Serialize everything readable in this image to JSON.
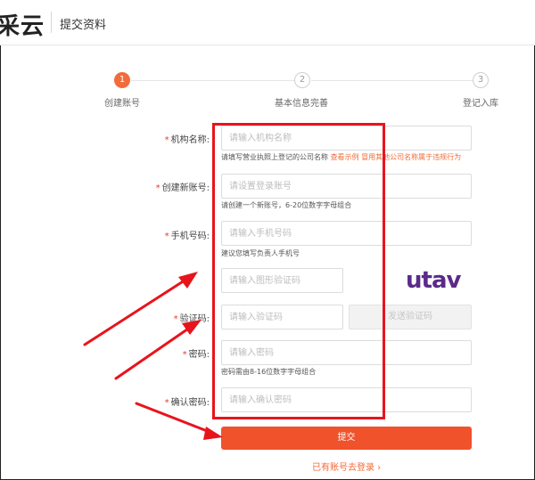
{
  "header": {
    "logo": "采云",
    "title": "提交资料"
  },
  "steps": [
    {
      "num": "1",
      "label": "创建账号",
      "active": true
    },
    {
      "num": "2",
      "label": "基本信息完善",
      "active": false
    },
    {
      "num": "3",
      "label": "登记入库",
      "active": false
    }
  ],
  "form": {
    "org_name": {
      "label": "机构名称:",
      "placeholder": "请输入机构名称",
      "hint": "请填写营业执照上登记的公司名称",
      "hint_link1": "查看示例",
      "hint_link2": "冒用其他公司名称属于违规行为"
    },
    "account": {
      "label": "创建新账号:",
      "placeholder": "请设置登录账号",
      "hint": "请创建一个新账号，6-20位数字字母组合"
    },
    "phone": {
      "label": "手机号码:",
      "placeholder": "请输入手机号码",
      "hint": "建议您填写负责人手机号"
    },
    "captcha": {
      "placeholder": "请输入图形验证码",
      "image_text": "utav"
    },
    "code": {
      "label": "验证码:",
      "placeholder": "请输入验证码",
      "send_label": "发送验证码"
    },
    "password": {
      "label": "密码:",
      "placeholder": "请输入密码",
      "hint": "密码需由8-16位数字字母组合"
    },
    "confirm": {
      "label": "确认密码:",
      "placeholder": "请输入确认密码"
    },
    "required_mark": "*"
  },
  "submit_label": "提交",
  "login_link": "已有账号去登录 ›",
  "colors": {
    "accent": "#f26b3a",
    "submit": "#f0522b",
    "annotation": "#e8141c"
  }
}
